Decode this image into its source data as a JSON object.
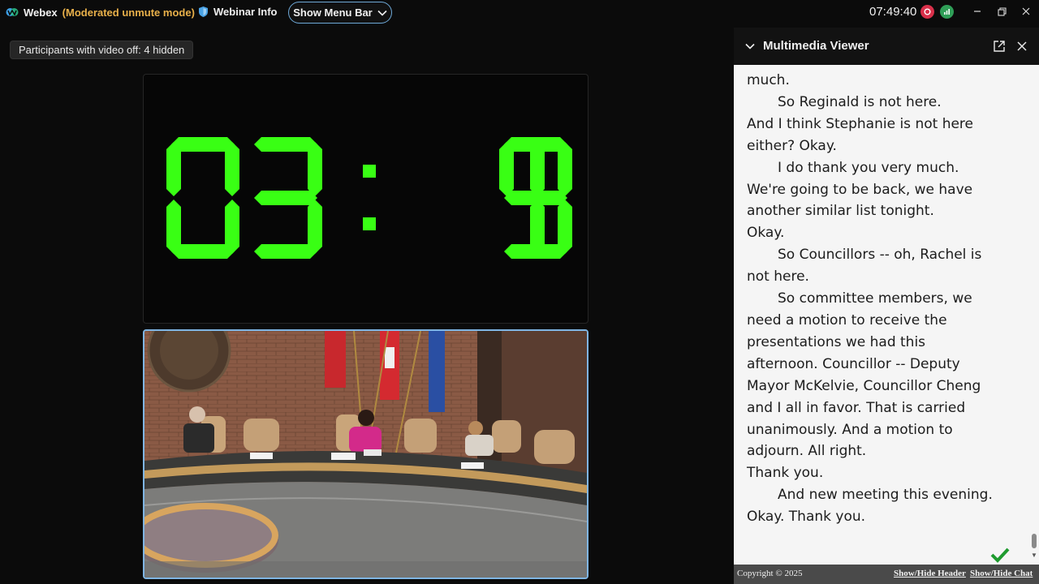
{
  "app": {
    "name": "Webex",
    "mode": "(Moderated unmute mode)",
    "webinar_info_label": "Webinar Info",
    "menu_bar_label": "Show Menu Bar",
    "time": "07:49:40"
  },
  "participants_notice": "Participants with video off: 4 hidden",
  "timer": {
    "minutes": "03",
    "seconds": "19",
    "digit_color": "#39ff14"
  },
  "multimedia_viewer": {
    "title": "Multimedia Viewer",
    "transcript": [
      {
        "text": "much.",
        "indent": false
      },
      {
        "text": "So Reginald is not here.",
        "indent": true
      },
      {
        "text": "And I think Stephanie is not here",
        "indent": false
      },
      {
        "text": "either? Okay.",
        "indent": false
      },
      {
        "text": "I do thank you very much.",
        "indent": true
      },
      {
        "text": "We're going to be back, we have",
        "indent": false
      },
      {
        "text": "another similar list tonight.",
        "indent": false
      },
      {
        "text": "Okay.",
        "indent": false
      },
      {
        "text": "So Councillors -- oh, Rachel is",
        "indent": true
      },
      {
        "text": "not here.",
        "indent": false
      },
      {
        "text": "So committee members, we",
        "indent": true
      },
      {
        "text": "need a motion to receive the",
        "indent": false
      },
      {
        "text": "presentations we had this",
        "indent": false
      },
      {
        "text": "afternoon. Councillor -- Deputy",
        "indent": false
      },
      {
        "text": "Mayor McKelvie, Councillor Cheng",
        "indent": false
      },
      {
        "text": "and I all in favor. That is carried",
        "indent": false
      },
      {
        "text": "unanimously. And a motion to",
        "indent": false
      },
      {
        "text": "adjourn. All right.",
        "indent": false
      },
      {
        "text": "Thank you.",
        "indent": false
      },
      {
        "text": "And new meeting this evening.",
        "indent": true
      },
      {
        "text": "Okay. Thank you.",
        "indent": false
      }
    ],
    "footer": {
      "copyright": "Copyright © 2025",
      "toggle_header": "Show/Hide Header",
      "toggle_chat": "Show/Hide Chat"
    }
  },
  "colors": {
    "accent_border": "#7fb5e3",
    "recording": "#d9304a",
    "health": "#2f9e57",
    "mode_text": "#e8b04a"
  }
}
